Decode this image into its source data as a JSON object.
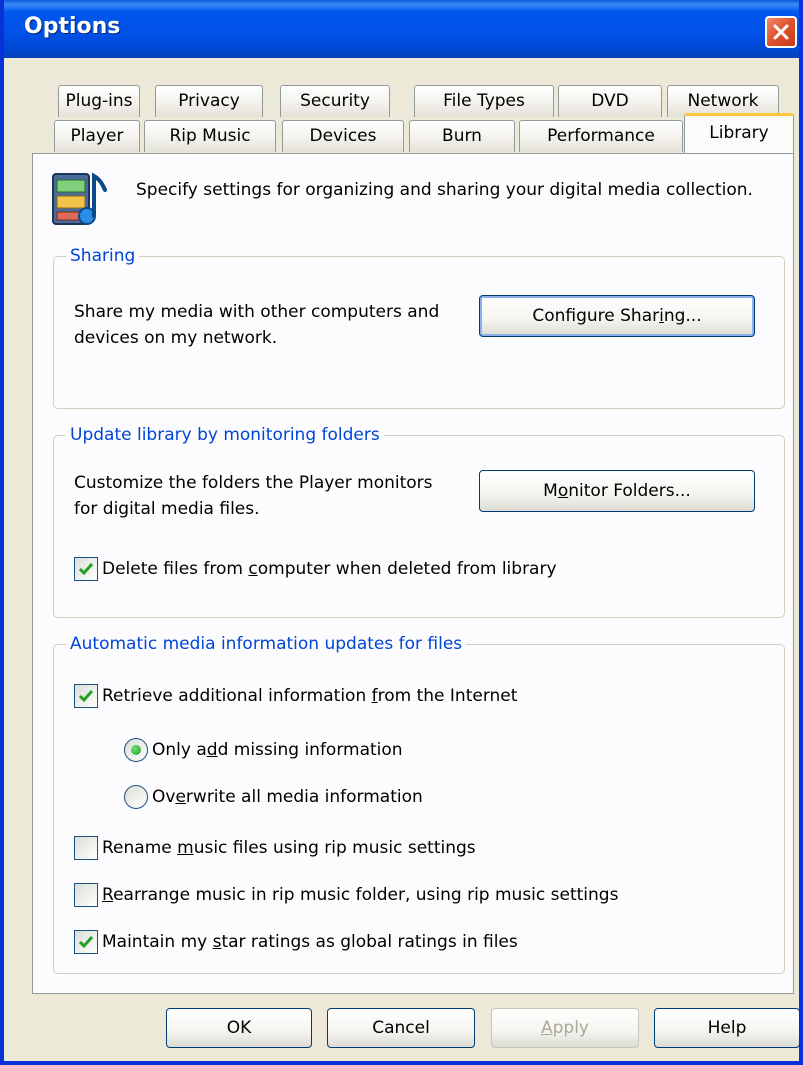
{
  "window": {
    "title": "Options"
  },
  "tabs": {
    "row_back": [
      {
        "label": "Plug-ins"
      },
      {
        "label": "Privacy"
      },
      {
        "label": "Security"
      },
      {
        "label": "File Types"
      },
      {
        "label": "DVD"
      },
      {
        "label": "Network"
      }
    ],
    "row_front": [
      {
        "label": "Player"
      },
      {
        "label": "Rip Music"
      },
      {
        "label": "Devices"
      },
      {
        "label": "Burn"
      },
      {
        "label": "Performance"
      },
      {
        "label": "Library"
      }
    ],
    "active": "Library"
  },
  "intro": {
    "icon": "media-library-icon",
    "text": "Specify settings for organizing and sharing your digital media collection."
  },
  "sharing": {
    "legend": "Sharing",
    "description": "Share my media with other computers and devices on my network.",
    "button": {
      "pre": "Configure Shar",
      "accel": "i",
      "post": "ng..."
    }
  },
  "monitor": {
    "legend": "Update library by monitoring folders",
    "description": "Customize the folders the Player monitors for digital media files.",
    "button": {
      "pre": "M",
      "accel": "o",
      "post": "nitor Folders..."
    },
    "delete_files": {
      "pre": "Delete files from ",
      "accel": "c",
      "post": "omputer when deleted from library",
      "checked": true
    }
  },
  "auto": {
    "legend": "Automatic media information updates for files",
    "retrieve": {
      "pre": "Retrieve additional information ",
      "accel": "f",
      "post": "rom the Internet",
      "checked": true
    },
    "only_missing": {
      "pre": "Only a",
      "accel": "d",
      "post": "d missing information",
      "selected": true
    },
    "overwrite_all": {
      "pre": "Ov",
      "accel": "e",
      "post": "rwrite all media information",
      "selected": false
    },
    "rename": {
      "pre": "Rename ",
      "accel": "m",
      "post": "usic files using rip music settings",
      "checked": false
    },
    "rearrange": {
      "pre": "",
      "accel": "R",
      "post": "earrange music in rip music folder, using rip music settings",
      "checked": false
    },
    "ratings": {
      "pre": "Maintain my ",
      "accel": "s",
      "post": "tar ratings as global ratings in files",
      "checked": true
    }
  },
  "footer": {
    "ok": "OK",
    "cancel": "Cancel",
    "apply": {
      "pre": "",
      "accel": "A",
      "post": "pply"
    },
    "help": "Help"
  },
  "colors": {
    "title_bar": "#0054e3",
    "legend_text": "#0046d5",
    "active_tab_highlight": "#ffc83c",
    "check_mark": "#21a121"
  }
}
